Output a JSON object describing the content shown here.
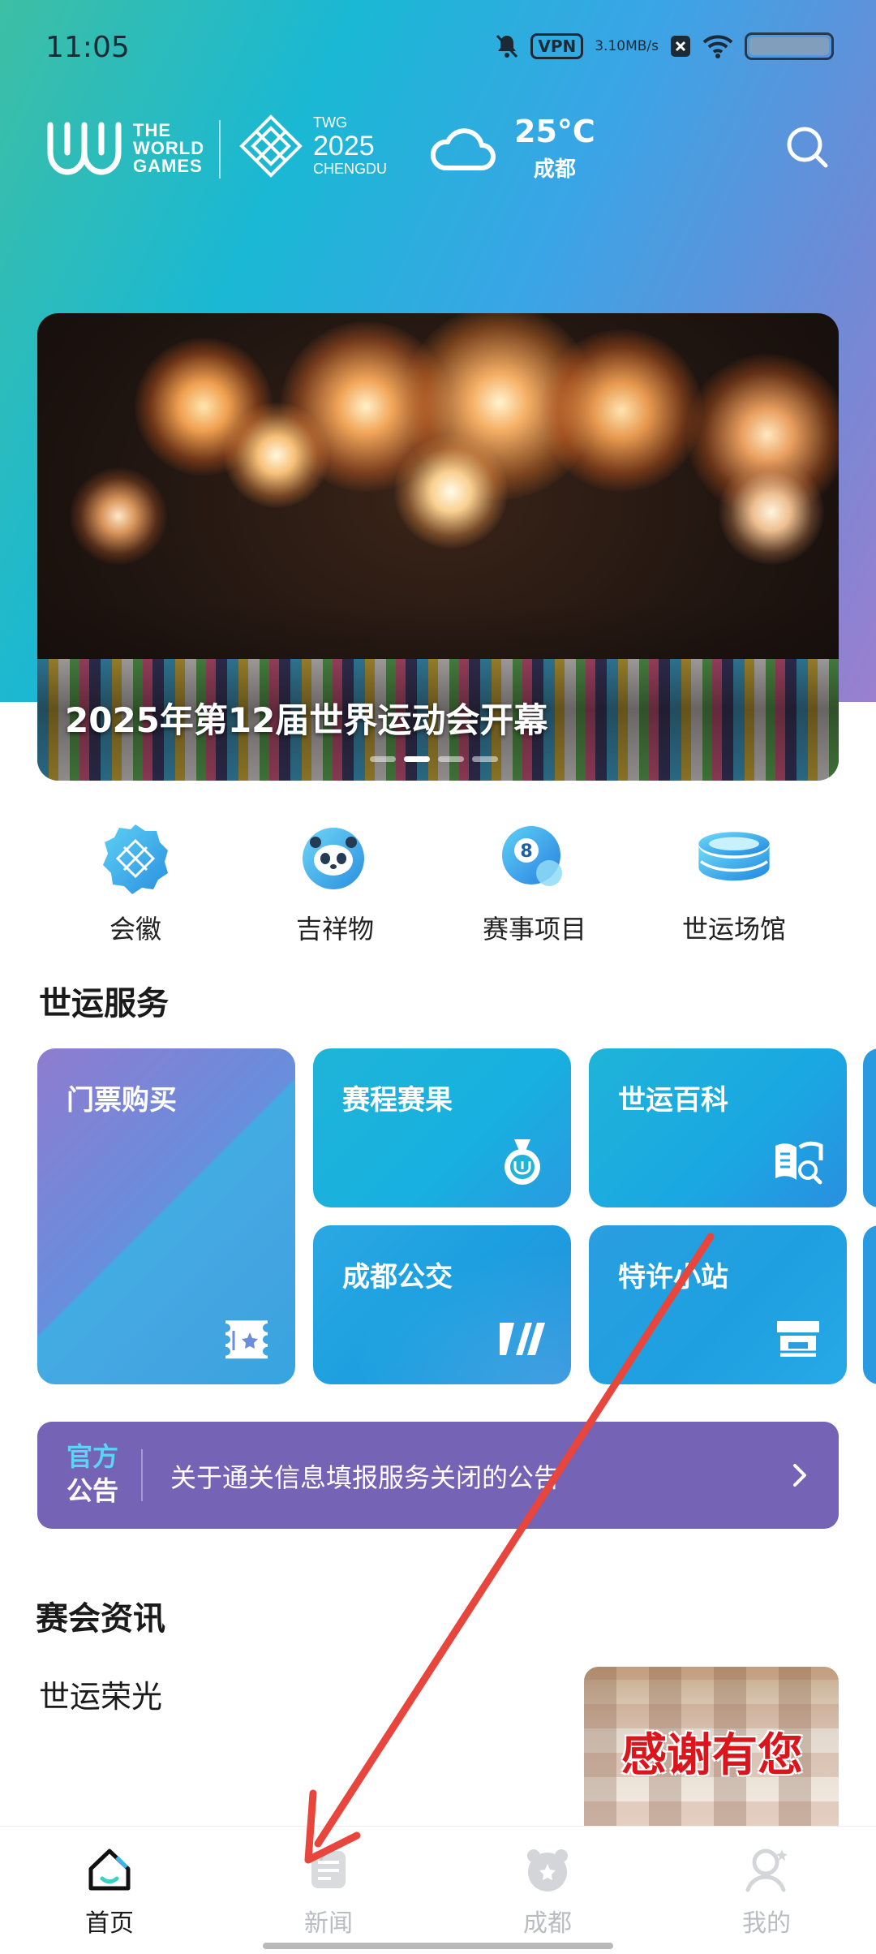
{
  "status_bar": {
    "time": "11:05",
    "vpn": "VPN",
    "speed_value": "3.10",
    "speed_unit": "MB/s",
    "icons": [
      "mute-bell-icon",
      "vpn-icon",
      "close-box-icon",
      "wifi-icon",
      "battery-icon"
    ]
  },
  "header": {
    "wg_logo_lines": [
      "THE",
      "WORLD",
      "GAMES"
    ],
    "twg_small": "TWG",
    "twg_year": "2025",
    "twg_city": "CHENGDU",
    "temperature": "25°C",
    "city": "成都",
    "icons": [
      "cloud-icon",
      "search-icon"
    ]
  },
  "banner": {
    "title": "2025年第12届世界运动会开幕",
    "slide_count": 4,
    "active_slide": 2
  },
  "quick_links": [
    {
      "label": "会徽",
      "icon": "emblem-icon"
    },
    {
      "label": "吉祥物",
      "icon": "panda-mascot-icon"
    },
    {
      "label": "赛事项目",
      "icon": "billiard-ball-icon"
    },
    {
      "label": "世运场馆",
      "icon": "stadium-icon"
    }
  ],
  "services": {
    "title": "世运服务",
    "items": [
      {
        "label": "门票购买",
        "icon": "ticket-icon"
      },
      {
        "label": "赛程赛果",
        "icon": "medal-icon"
      },
      {
        "label": "世运百科",
        "icon": "book-search-icon"
      },
      {
        "label": "成都公交",
        "icon": "bus-logo-icon"
      },
      {
        "label": "特许小站",
        "icon": "shop-icon"
      }
    ]
  },
  "notice": {
    "tag_line1": "官方",
    "tag_line2": "公告",
    "text": "关于通关信息填报服务关闭的公告"
  },
  "news": {
    "section_title": "赛会资讯",
    "item_title": "世运荣光",
    "thumb_text": "感谢有您"
  },
  "bottom_nav": [
    {
      "label": "首页",
      "icon": "home-icon",
      "active": true
    },
    {
      "label": "新闻",
      "icon": "news-icon",
      "active": false
    },
    {
      "label": "成都",
      "icon": "panda-face-icon",
      "active": false
    },
    {
      "label": "我的",
      "icon": "profile-icon",
      "active": false
    }
  ],
  "colors": {
    "notice_bg": "#7563b5",
    "annotation_arrow": "#e8453c"
  }
}
